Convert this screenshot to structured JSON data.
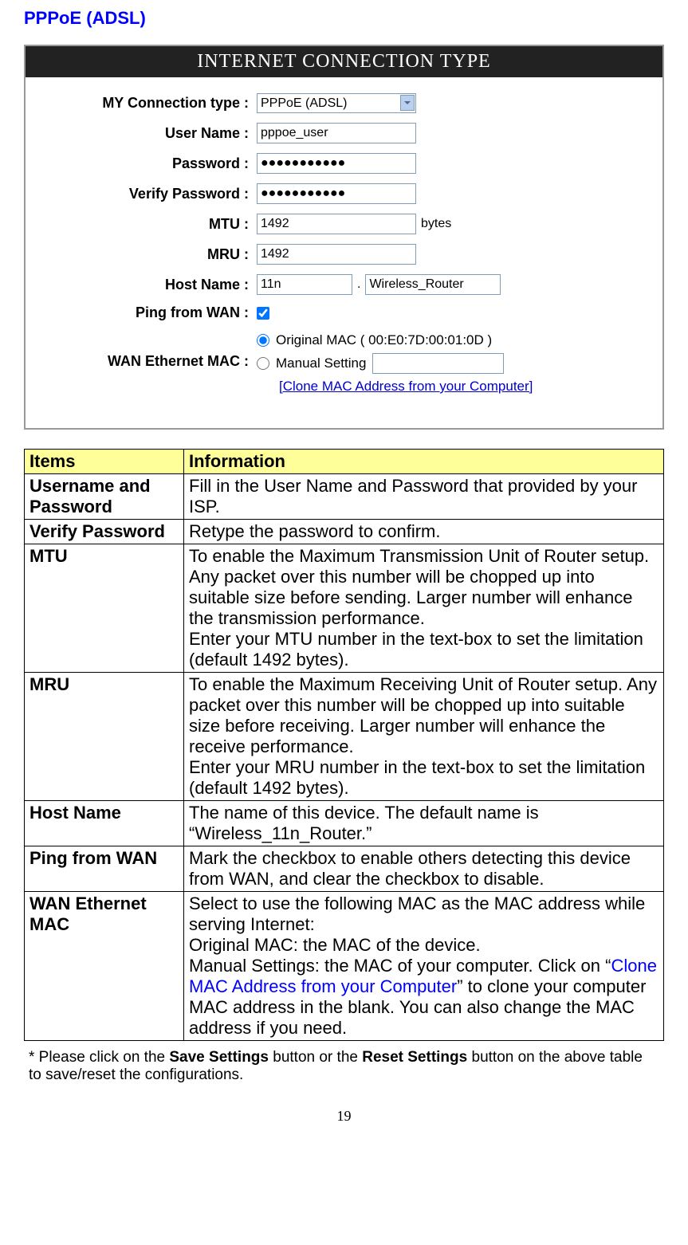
{
  "title": "PPPoE (ADSL)",
  "panel": {
    "header": "INTERNET CONNECTION TYPE",
    "labels": {
      "conn_type": "MY Connection type :",
      "user_name": "User Name :",
      "password": "Password :",
      "verify_password": "Verify Password :",
      "mtu": "MTU :",
      "mru": "MRU :",
      "host_name": "Host Name :",
      "ping_wan": "Ping from WAN :",
      "wan_mac": "WAN Ethernet MAC :"
    },
    "values": {
      "conn_type": "PPPoE (ADSL)",
      "user_name": "pppoe_user",
      "password": "●●●●●●●●●●●",
      "verify_password": "●●●●●●●●●●●",
      "mtu": "1492",
      "mtu_unit": "bytes",
      "mru": "1492",
      "host1": "11n",
      "host_dot": ".",
      "host2": "Wireless_Router",
      "original_mac_label": "Original MAC ( 00:E0:7D:00:01:0D )",
      "manual_label": "Manual Setting",
      "clone_link": "[Clone MAC Address from your Computer]"
    }
  },
  "table": {
    "headers": {
      "items": "Items",
      "info": "Information"
    },
    "rows": [
      {
        "item": "Username and Password",
        "info": "Fill in the User Name and Password that provided by your ISP."
      },
      {
        "item": "Verify Password",
        "info": "Retype the password to confirm."
      },
      {
        "item": "MTU",
        "info_html": "To enable the Maximum Transmission Unit of Router setup. Any packet over this number will be chopped up into suitable size before sending. Larger number will enhance the transmission performance.\nEnter your MTU number in the text-box to set the limitation (default 1492 bytes)."
      },
      {
        "item": "MRU",
        "info_html": "To enable the Maximum Receiving Unit of Router setup. Any packet over this number will be chopped up into suitable size before receiving. Larger number will enhance the receive performance.\nEnter your MRU number in the text-box to set the limitation (default 1492 bytes)."
      },
      {
        "item": "Host Name",
        "info": "The name of this device. The default name is “Wireless_11n_Router.”"
      },
      {
        "item": "Ping from WAN",
        "info": "Mark the checkbox to enable others detecting this device from WAN, and clear the checkbox to disable."
      },
      {
        "item": "WAN Ethernet MAC",
        "info_parts": {
          "p1": "Select to use the following MAC as the MAC address while serving Internet:",
          "p2": "Original MAC: the MAC of the device.",
          "p3a": "Manual Settings: the MAC of your computer. Click on “",
          "p3link": "Clone MAC Address from your Computer",
          "p3b": "” to clone your computer MAC address in the blank. You can also change the MAC address if you need."
        }
      }
    ]
  },
  "footnote": {
    "prefix": "* Please click on the ",
    "b1": "Save Settings",
    "mid": " button or the ",
    "b2": "Reset Settings",
    "suffix": " button on the above table to save/reset the configurations."
  },
  "page_number": "19"
}
